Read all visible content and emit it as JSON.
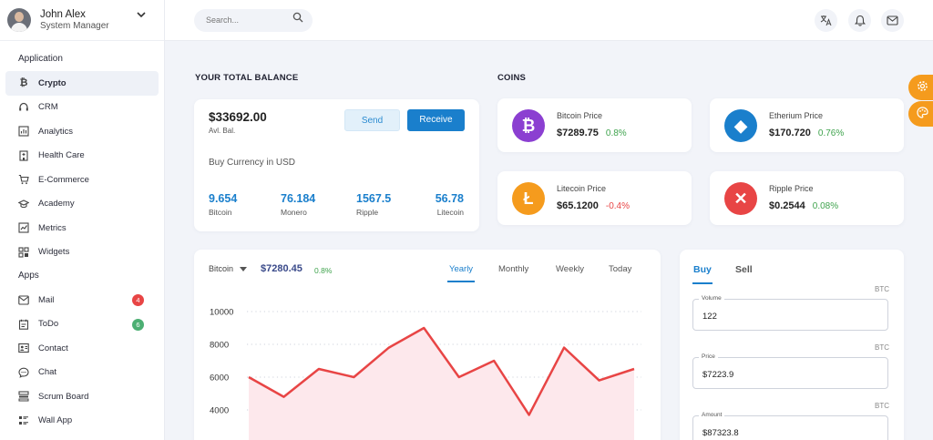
{
  "profile": {
    "name": "John Alex",
    "role": "System Manager"
  },
  "sidebar": {
    "application_title": "Application",
    "application_items": [
      {
        "label": "Crypto",
        "icon": "bitcoin-icon"
      },
      {
        "label": "CRM",
        "icon": "headset-icon"
      },
      {
        "label": "Analytics",
        "icon": "analytics-icon"
      },
      {
        "label": "Health Care",
        "icon": "hospital-icon"
      },
      {
        "label": "E-Commerce",
        "icon": "cart-icon"
      },
      {
        "label": "Academy",
        "icon": "graduation-cap-icon"
      },
      {
        "label": "Metrics",
        "icon": "metrics-icon"
      },
      {
        "label": "Widgets",
        "icon": "widgets-icon"
      }
    ],
    "apps_title": "Apps",
    "apps_items": [
      {
        "label": "Mail",
        "icon": "mail-icon",
        "badge": "4",
        "badge_color": "#e84545"
      },
      {
        "label": "ToDo",
        "icon": "todo-icon",
        "badge": "6",
        "badge_color": "#4caf73"
      },
      {
        "label": "Contact",
        "icon": "contact-icon"
      },
      {
        "label": "Chat",
        "icon": "chat-icon"
      },
      {
        "label": "Scrum Board",
        "icon": "scrum-board-icon"
      },
      {
        "label": "Wall App",
        "icon": "wall-app-icon"
      }
    ]
  },
  "topbar": {
    "search_placeholder": "Search..."
  },
  "balance": {
    "title": "YOUR TOTAL BALANCE",
    "amount": "$33692.00",
    "sub": "Avl. Bal.",
    "send_label": "Send",
    "receive_label": "Receive",
    "buy_currency": "Buy Currency in USD",
    "currencies": [
      {
        "value": "9.654",
        "label": "Bitcoin"
      },
      {
        "value": "76.184",
        "label": "Monero"
      },
      {
        "value": "1567.5",
        "label": "Ripple"
      },
      {
        "value": "56.78",
        "label": "Litecoin"
      }
    ]
  },
  "coins": {
    "title": "COINS",
    "items": [
      {
        "name": "Bitcoin Price",
        "value": "$7289.75",
        "change": "0.8%",
        "change_color": "#3fa34d",
        "icon_color": "#8b3fd1",
        "symbol": "₿"
      },
      {
        "name": "Etherium Price",
        "value": "$170.720",
        "change": "0.76%",
        "change_color": "#3fa34d",
        "icon_color": "#1a7fcc",
        "symbol": "◆"
      },
      {
        "name": "Litecoin Price",
        "value": "$65.1200",
        "change": "-0.4%",
        "change_color": "#e84545",
        "icon_color": "#f59b1d",
        "symbol": "Ł"
      },
      {
        "name": "Ripple Price",
        "value": "$0.2544",
        "change": "0.08%",
        "change_color": "#3fa34d",
        "icon_color": "#e84545",
        "symbol": "✕"
      }
    ]
  },
  "chart_card": {
    "coin_select": "Bitcoin",
    "price": "$7280.45",
    "change": "0.8%",
    "tabs": [
      "Yearly",
      "Monthly",
      "Weekly",
      "Today"
    ],
    "active_tab": "Yearly"
  },
  "chart_data": {
    "type": "area",
    "title": "",
    "xlabel": "",
    "ylabel": "",
    "y_ticks": [
      "10000",
      "8000",
      "6000",
      "4000"
    ],
    "ylim": [
      2000,
      11000
    ],
    "series": [
      {
        "values": [
          6000,
          4800,
          6500,
          6000,
          7800,
          9000,
          6000,
          7000,
          3700,
          7800,
          5800,
          6500
        ],
        "color": "#e84545"
      }
    ],
    "grid": true
  },
  "trade": {
    "tabs": [
      "Buy",
      "Sell"
    ],
    "unit": "BTC",
    "volume_label": "Volume",
    "volume_value": "122",
    "price_label": "Price",
    "price_value": "$7223.9",
    "amount_label": "Amount",
    "amount_value": "$87323.8"
  }
}
